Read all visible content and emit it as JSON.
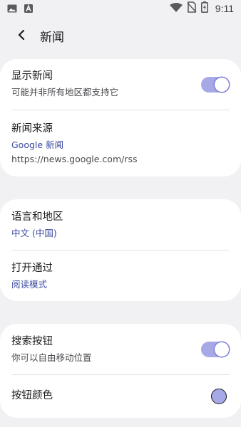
{
  "status_bar": {
    "time": "9:11",
    "icons": [
      "image-icon",
      "font-icon",
      "wifi-icon",
      "no-sim-icon",
      "battery-charging-icon"
    ]
  },
  "header": {
    "title": "新闻"
  },
  "card1": {
    "show_news_title": "显示新闻",
    "show_news_sub": "可能并非所有地区都支持它",
    "show_news_enabled": true,
    "source_title": "新闻来源",
    "source_value": "Google 新闻",
    "source_url": "https://news.google.com/rss"
  },
  "card2": {
    "language_title": "语言和地区",
    "language_value": "中文 (中国)",
    "open_with_title": "打开通过",
    "open_with_value": "阅读模式"
  },
  "card3": {
    "search_button_title": "搜索按钮",
    "search_button_sub": "你可以自由移动位置",
    "search_button_enabled": true,
    "button_color_title": "按钮颜色",
    "button_color": "#a7a8e6"
  },
  "colors": {
    "accent": "#a7a8e6",
    "link": "#3b4aa0",
    "background": "#f1f1f3",
    "card": "#ffffff"
  }
}
